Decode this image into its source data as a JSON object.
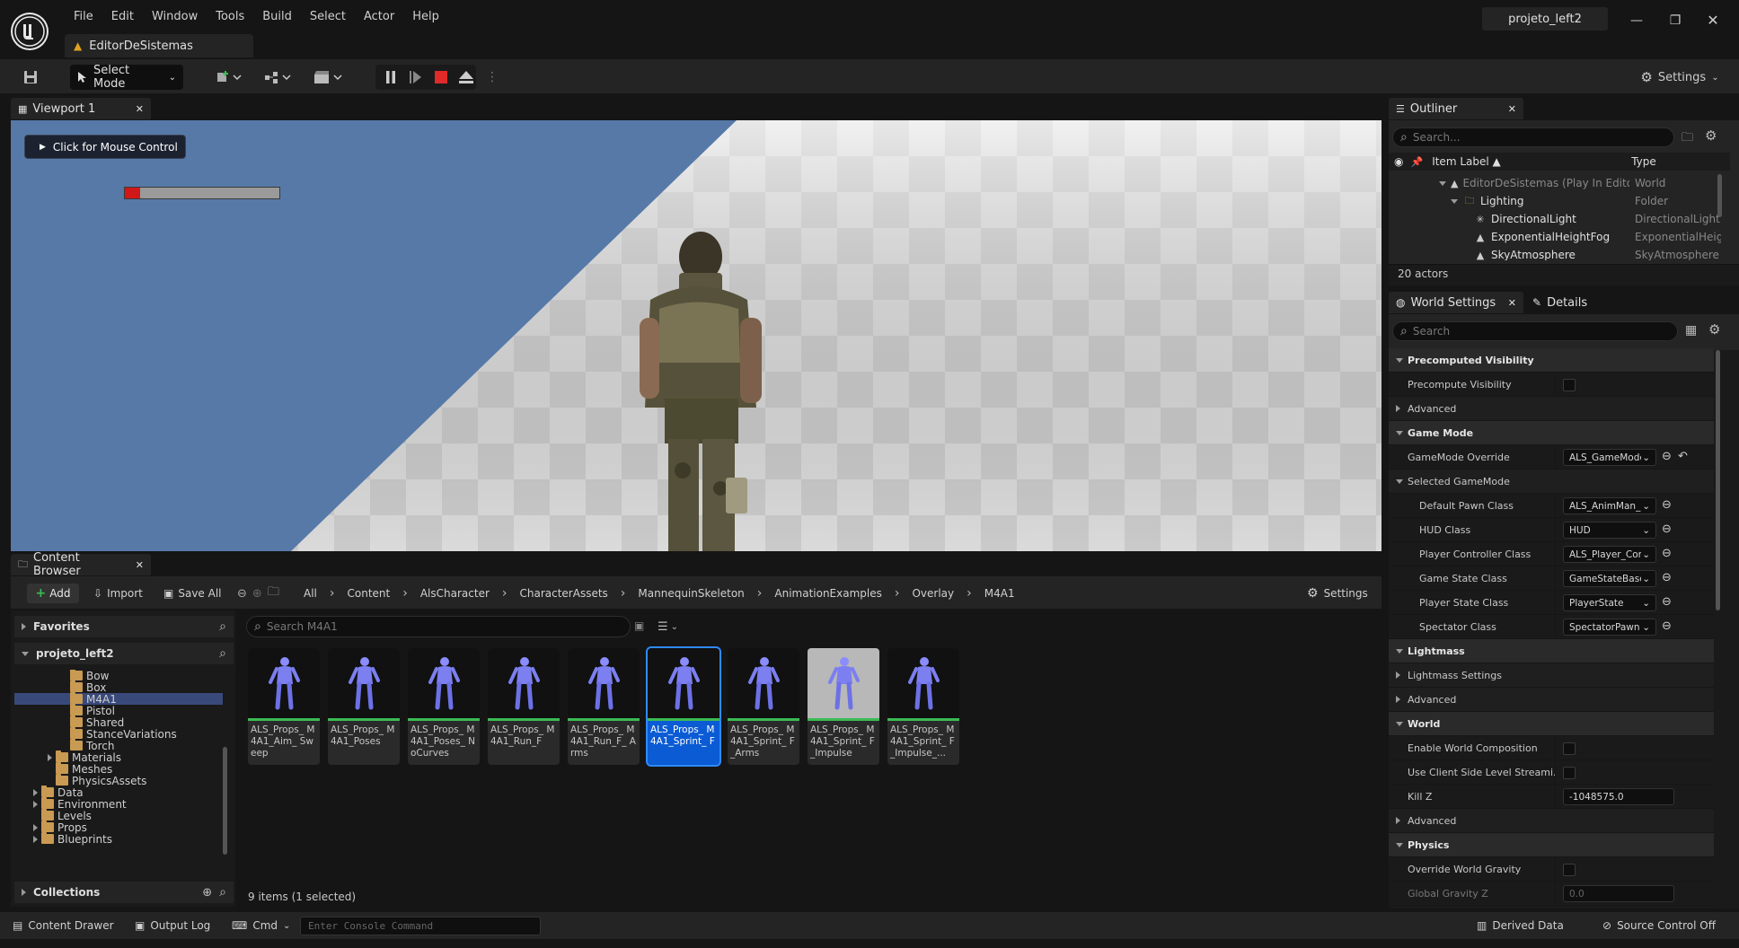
{
  "app": {
    "menu": [
      "File",
      "Edit",
      "Window",
      "Tools",
      "Build",
      "Select",
      "Actor",
      "Help"
    ],
    "level_tab": "EditorDeSistemas",
    "project": "projeto_left2"
  },
  "toolbar": {
    "select_mode": "Select Mode",
    "settings": "Settings"
  },
  "viewport": {
    "tab": "Viewport 1",
    "mouse_control": "Click for Mouse Control",
    "health_fraction": 0.1
  },
  "content_browser": {
    "tab": "Content Browser",
    "add": "Add",
    "import": "Import",
    "save_all": "Save All",
    "breadcrumb": [
      "All",
      "Content",
      "AlsCharacter",
      "CharacterAssets",
      "MannequinSkeleton",
      "AnimationExamples",
      "Overlay",
      "M4A1"
    ],
    "settings": "Settings",
    "favorites": "Favorites",
    "project": "projeto_left2",
    "collections": "Collections",
    "search_placeholder": "Search M4A1",
    "tree": [
      {
        "label": "Bow",
        "indent": 3,
        "exp": false
      },
      {
        "label": "Box",
        "indent": 3,
        "exp": false
      },
      {
        "label": "M4A1",
        "indent": 3,
        "exp": false,
        "selected": true
      },
      {
        "label": "Pistol",
        "indent": 3,
        "exp": false
      },
      {
        "label": "Shared",
        "indent": 3,
        "exp": false
      },
      {
        "label": "StanceVariations",
        "indent": 3,
        "exp": false
      },
      {
        "label": "Torch",
        "indent": 3,
        "exp": false
      },
      {
        "label": "Materials",
        "indent": 2,
        "exp": true
      },
      {
        "label": "Meshes",
        "indent": 2,
        "exp": false
      },
      {
        "label": "PhysicsAssets",
        "indent": 2,
        "exp": false
      },
      {
        "label": "Data",
        "indent": 1,
        "exp": true
      },
      {
        "label": "Environment",
        "indent": 1,
        "exp": true
      },
      {
        "label": "Levels",
        "indent": 1,
        "exp": false
      },
      {
        "label": "Props",
        "indent": 1,
        "exp": true
      },
      {
        "label": "Blueprints",
        "indent": 1,
        "exp": true
      }
    ],
    "assets": [
      {
        "name": "ALS_Props_ M4A1_Aim_ Sweep"
      },
      {
        "name": "ALS_Props_ M4A1_Poses"
      },
      {
        "name": "ALS_Props_ M4A1_Poses_ NoCurves"
      },
      {
        "name": "ALS_Props_ M4A1_Run_F"
      },
      {
        "name": "ALS_Props_ M4A1_Run_F_ Arms"
      },
      {
        "name": "ALS_Props_ M4A1_Sprint_ F",
        "selected": true
      },
      {
        "name": "ALS_Props_ M4A1_Sprint_ F_Arms"
      },
      {
        "name": "ALS_Props_ M4A1_Sprint_ F_Impulse",
        "preview": true
      },
      {
        "name": "ALS_Props_ M4A1_Sprint_ F_Impulse_..."
      }
    ],
    "item_count": "9 items (1 selected)"
  },
  "outliner": {
    "tab": "Outliner",
    "search_placeholder": "Search...",
    "col_label": "Item Label ▲",
    "col_type": "Type",
    "rows": [
      {
        "label": "EditorDeSistemas (Play In Editor)",
        "type": "World",
        "indent": 0,
        "icon": "world",
        "dim": true
      },
      {
        "label": "Lighting",
        "type": "Folder",
        "indent": 1,
        "icon": "folder"
      },
      {
        "label": "DirectionalLight",
        "type": "DirectionalLight",
        "indent": 2,
        "icon": "light"
      },
      {
        "label": "ExponentialHeightFog",
        "type": "ExponentialHeightFog",
        "indent": 2,
        "icon": "fog"
      },
      {
        "label": "SkyAtmosphere",
        "type": "SkyAtmosphere",
        "indent": 2,
        "icon": "sky"
      }
    ],
    "actor_count": "20 actors"
  },
  "details": {
    "tab_world": "World Settings",
    "tab_details": "Details",
    "search_placeholder": "Search",
    "rows": [
      {
        "kind": "cat",
        "label": "Precomputed Visibility"
      },
      {
        "kind": "prop",
        "label": "Precompute Visibility",
        "control": "check"
      },
      {
        "kind": "sub",
        "label": "Advanced"
      },
      {
        "kind": "cat",
        "label": "Game Mode"
      },
      {
        "kind": "prop",
        "label": "GameMode Override",
        "control": "combo",
        "value": "ALS_GameMode_S",
        "reset": true
      },
      {
        "kind": "sub",
        "label": "Selected GameMode",
        "open": true
      },
      {
        "kind": "prop2",
        "label": "Default Pawn Class",
        "control": "combo",
        "value": "ALS_AnimMan_Ch"
      },
      {
        "kind": "prop2",
        "label": "HUD Class",
        "control": "combo",
        "value": "HUD"
      },
      {
        "kind": "prop2",
        "label": "Player Controller Class",
        "control": "combo",
        "value": "ALS_Player_Contr"
      },
      {
        "kind": "prop2",
        "label": "Game State Class",
        "control": "combo",
        "value": "GameStateBase"
      },
      {
        "kind": "prop2",
        "label": "Player State Class",
        "control": "combo",
        "value": "PlayerState"
      },
      {
        "kind": "prop2",
        "label": "Spectator Class",
        "control": "combo",
        "value": "SpectatorPawn"
      },
      {
        "kind": "cat",
        "label": "Lightmass"
      },
      {
        "kind": "sub",
        "label": "Lightmass Settings"
      },
      {
        "kind": "sub",
        "label": "Advanced"
      },
      {
        "kind": "cat",
        "label": "World"
      },
      {
        "kind": "prop",
        "label": "Enable World Composition",
        "control": "check"
      },
      {
        "kind": "prop",
        "label": "Use Client Side Level Streami...",
        "control": "check"
      },
      {
        "kind": "prop",
        "label": "Kill Z",
        "control": "num",
        "value": "-1048575.0"
      },
      {
        "kind": "sub",
        "label": "Advanced"
      },
      {
        "kind": "cat",
        "label": "Physics"
      },
      {
        "kind": "prop",
        "label": "Override World Gravity",
        "control": "check"
      },
      {
        "kind": "prop",
        "label": "Global Gravity Z",
        "control": "num",
        "value": "0.0",
        "dim": true
      }
    ]
  },
  "statusbar": {
    "content_drawer": "Content Drawer",
    "output_log": "Output Log",
    "cmd": "Cmd",
    "console_placeholder": "Enter Console Command",
    "derived_data": "Derived Data",
    "source_control": "Source Control Off"
  }
}
